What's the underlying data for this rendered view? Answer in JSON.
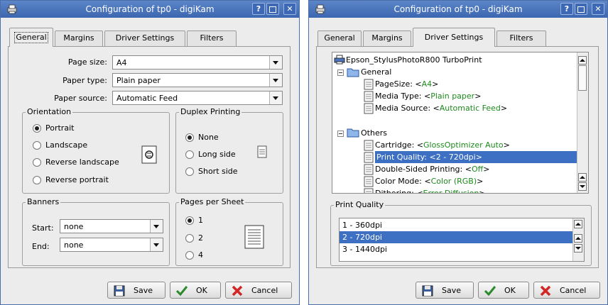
{
  "left": {
    "title": "Configuration of tp0 - digiKam",
    "tabs": [
      "General",
      "Margins",
      "Driver Settings",
      "Filters"
    ],
    "page_size": {
      "label": "Page size:",
      "value": "A4"
    },
    "paper_type": {
      "label": "Paper type:",
      "value": "Plain paper"
    },
    "paper_source": {
      "label": "Paper source:",
      "value": "Automatic Feed"
    },
    "orientation": {
      "title": "Orientation",
      "options": [
        "Portrait",
        "Landscape",
        "Reverse landscape",
        "Reverse portrait"
      ],
      "selected": "Portrait"
    },
    "duplex": {
      "title": "Duplex Printing",
      "options": [
        "None",
        "Long side",
        "Short side"
      ],
      "selected": "None"
    },
    "banners": {
      "title": "Banners",
      "start_label": "Start:",
      "start_value": "none",
      "end_label": "End:",
      "end_value": "none"
    },
    "pages_per_sheet": {
      "title": "Pages per Sheet",
      "options": [
        "1",
        "2",
        "4"
      ],
      "selected": "1"
    }
  },
  "right": {
    "title": "Configuration of tp0 - digiKam",
    "tabs": [
      "General",
      "Margins",
      "Driver Settings",
      "Filters"
    ],
    "tree": {
      "root": "Epson_StylusPhotoR800 TurboPrint",
      "general_label": "General",
      "general_items": [
        {
          "name": "PageSize: <",
          "value": "A4",
          "end": ">"
        },
        {
          "name": "Media Type: <",
          "value": "Plain paper",
          "end": ">"
        },
        {
          "name": "Media Source: <",
          "value": "Automatic Feed",
          "end": ">"
        }
      ],
      "others_label": "Others",
      "others_items": [
        {
          "name": "Cartridge: <",
          "value": "GlossOptimizer Auto",
          "end": ">"
        },
        {
          "name": "Print Quality: <",
          "value": "2 - 720dpi",
          "end": ">"
        },
        {
          "name": "Double-Sided Printing: <",
          "value": "Off",
          "end": ">"
        },
        {
          "name": "Color Mode: <",
          "value": "Color (RGB)",
          "end": ">"
        },
        {
          "name": "Dithering: <",
          "value": "Error Diffusion",
          "end": ">"
        }
      ]
    },
    "print_quality": {
      "title": "Print Quality",
      "options": [
        "1 - 360dpi",
        "2 - 720dpi",
        "3 - 1440dpi"
      ],
      "selected": "2 - 720dpi"
    }
  },
  "buttons": {
    "save": "Save",
    "ok": "OK",
    "cancel": "Cancel"
  },
  "colors": {
    "titlebar": "#4a74bc",
    "selection": "#3d6fc2",
    "value_green": "#1c8a1c",
    "cancel_red": "#d42424"
  }
}
